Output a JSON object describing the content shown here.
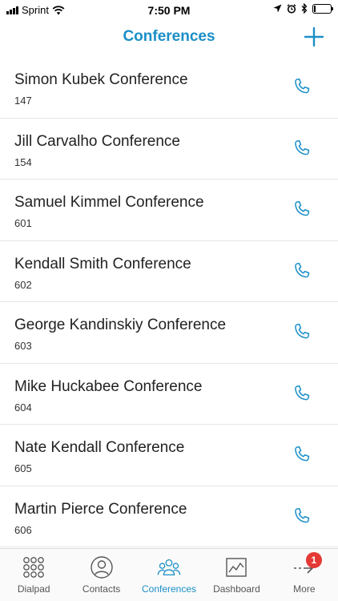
{
  "status_bar": {
    "carrier": "Sprint",
    "time": "7:50 PM",
    "battery_level": 0.1
  },
  "nav": {
    "title": "Conferences",
    "add_icon": "plus-icon"
  },
  "conferences": [
    {
      "name": "Simon Kubek Conference",
      "number": "147"
    },
    {
      "name": "Jill Carvalho Conference",
      "number": "154"
    },
    {
      "name": "Samuel Kimmel Conference",
      "number": "601"
    },
    {
      "name": "Kendall Smith Conference",
      "number": "602"
    },
    {
      "name": "George Kandinskiy Conference",
      "number": "603"
    },
    {
      "name": "Mike Huckabee Conference",
      "number": "604"
    },
    {
      "name": "Nate Kendall Conference",
      "number": "605"
    },
    {
      "name": "Martin Pierce Conference",
      "number": "606"
    }
  ],
  "tabs": [
    {
      "label": "Dialpad",
      "icon": "dialpad-icon",
      "active": false
    },
    {
      "label": "Contacts",
      "icon": "contact-icon",
      "active": false
    },
    {
      "label": "Conferences",
      "icon": "conference-icon",
      "active": true
    },
    {
      "label": "Dashboard",
      "icon": "dashboard-icon",
      "active": false
    },
    {
      "label": "More",
      "icon": "more-arrow-icon",
      "active": false,
      "badge": "1"
    }
  ],
  "colors": {
    "accent": "#1b8fc7",
    "badge": "#e53935"
  }
}
